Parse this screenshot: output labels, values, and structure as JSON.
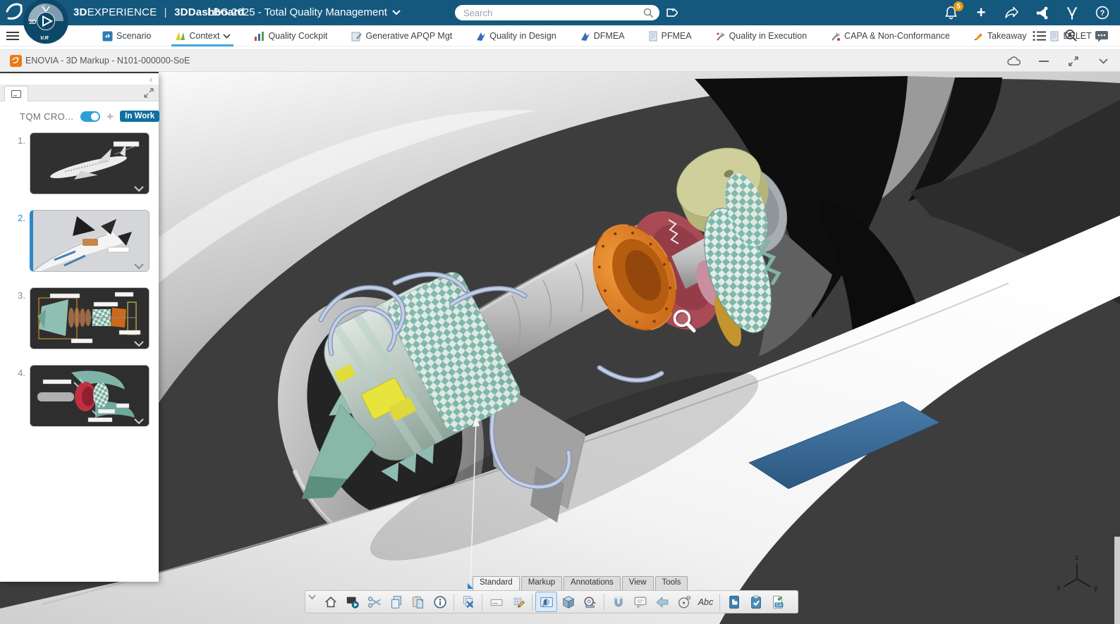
{
  "topbar": {
    "brand": {
      "bold": "3D",
      "rest": "EXPERIENCE",
      "divider": "|",
      "app": "3DDashboard"
    },
    "dashboard_title": "LBG 2025 - Total Quality Management",
    "search_placeholder": "Search",
    "notifications_badge": "5",
    "plus_label": "+",
    "help_label": "?",
    "compass": {
      "left": "3D",
      "bottom": "V.R"
    }
  },
  "tabbar": {
    "tabs": [
      {
        "label": "Scenario"
      },
      {
        "label": "Context"
      },
      {
        "label": "Quality Cockpit"
      },
      {
        "label": "Generative APQP Mgt"
      },
      {
        "label": "Quality in Design"
      },
      {
        "label": "DFMEA"
      },
      {
        "label": "PFMEA"
      },
      {
        "label": "Quality in Execution"
      },
      {
        "label": "CAPA & Non-Conformance"
      },
      {
        "label": "Takeaway"
      },
      {
        "label": "DELET"
      }
    ],
    "active_tab": "Context",
    "overflow_chevron": "›"
  },
  "titlebar": {
    "title": "ENOVIA - 3D Markup - N101-000000-SoE"
  },
  "sidebar": {
    "collapse_chevron": "‹",
    "panel_title": "TQM CRO...",
    "status_badge": "In Work",
    "items": [
      {
        "num": "1."
      },
      {
        "num": "2."
      },
      {
        "num": "3."
      },
      {
        "num": "4."
      }
    ]
  },
  "viewport": {
    "axis": {
      "x": "x",
      "y": "y",
      "z": "z"
    }
  },
  "bottom_toolbar": {
    "tabs": [
      {
        "label": "Standard"
      },
      {
        "label": "Markup"
      },
      {
        "label": "Annotations"
      },
      {
        "label": "View"
      },
      {
        "label": "Tools"
      }
    ],
    "active_tab": "Standard",
    "text_tool_label": "Abc",
    "ca_doc_label": "CA"
  },
  "colors": {
    "topbar_blue": "#15587E",
    "accent_blue": "#2E9FD6",
    "active_tab_underline": "#3CA7DC",
    "in_work_badge": "#0F6FA0",
    "notification_badge": "#E8960C",
    "viewport_bg": "#3D3D3D",
    "selection_bar": "#2E86C8",
    "flap_blue": "#3A6F9D"
  }
}
